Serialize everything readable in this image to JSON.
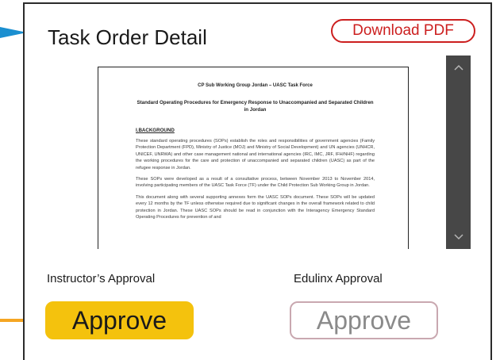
{
  "header": {
    "title": "Task Order Detail",
    "download_label": "Download PDF"
  },
  "document": {
    "header_line": "CP Sub Working Group Jordan – UASC Task Force",
    "title": "Standard Operating Procedures for Emergency Response to Unaccompanied and Separated Children in Jordan",
    "section": "I.BACKGROUND",
    "paragraphs": [
      "These standard operating procedures (SOPs) establish the roles and responsibilities of government agencies (Family Protection Department (FPD), Ministry of Justice (MOJ) and Ministry of Social Development) and UN agencies (UNHCR, UNICEF, UNRWA) and other case management national and international agencies (IRC, IMC, JRF, IFH/NHF) regarding the working procedures for the care and protection of unaccompanied and separated children (UASC) as part of the refugee response in Jordan.",
      "These SOPs were developed as a result of a consultative process, between November 2013 to November 2014, involving participating members of the UASC Task Force (TF) under the Child Protection Sub Working Group in Jordan.",
      "This document along with several supporting annexes form the UASC SOPs document. These SOPs will be updated every 12 months by the TF unless otherwise required due to significant changes in the overall framework related to child protection in Jordan. These UASC SOPs should be read in conjunction with the Interagency Emergency Standard Operating Procedures for prevention of and"
    ]
  },
  "scrollbar": {
    "up_icon": "chevron-up-icon",
    "down_icon": "chevron-down-icon"
  },
  "approvals": {
    "instructor": {
      "label": "Instructor’s Approval",
      "button": "Approve"
    },
    "edulinx": {
      "label": "Edulinx Approval",
      "button": "Approve"
    }
  },
  "colors": {
    "accent_blue": "#1b8fd0",
    "accent_orange": "#f5a623",
    "download_red": "#cc1f1f",
    "approve_yellow": "#f4c20d",
    "disabled_border": "#c9a8b0",
    "scrollbar_dark": "#474747"
  }
}
